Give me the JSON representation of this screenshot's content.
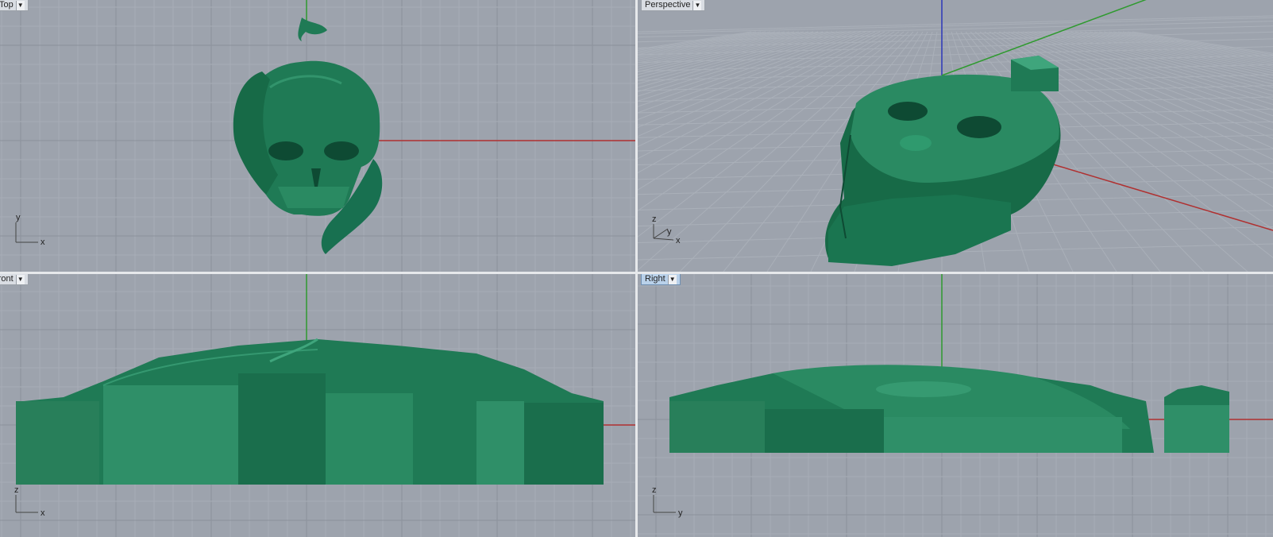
{
  "viewports": {
    "top": {
      "label": "Top",
      "axes": [
        "y",
        "x"
      ]
    },
    "persp": {
      "label": "Perspective",
      "axes": [
        "z",
        "y",
        "x"
      ]
    },
    "front": {
      "label": "Front",
      "axes": [
        "z",
        "x"
      ]
    },
    "right": {
      "label": "Right",
      "axes": [
        "z",
        "y"
      ]
    }
  },
  "colors": {
    "viewport_bg": "#9da3ad",
    "grid_minor": "#a8adb6",
    "grid_major": "#8c929c",
    "axis_x": "#b03030",
    "axis_y": "#2f9a2f",
    "axis_z": "#2c36b8",
    "model": "#1f7a55",
    "model_light": "#3fa57c",
    "model_dark": "#0e4a33"
  },
  "icons": {
    "dropdown": "chevron-down-icon"
  }
}
